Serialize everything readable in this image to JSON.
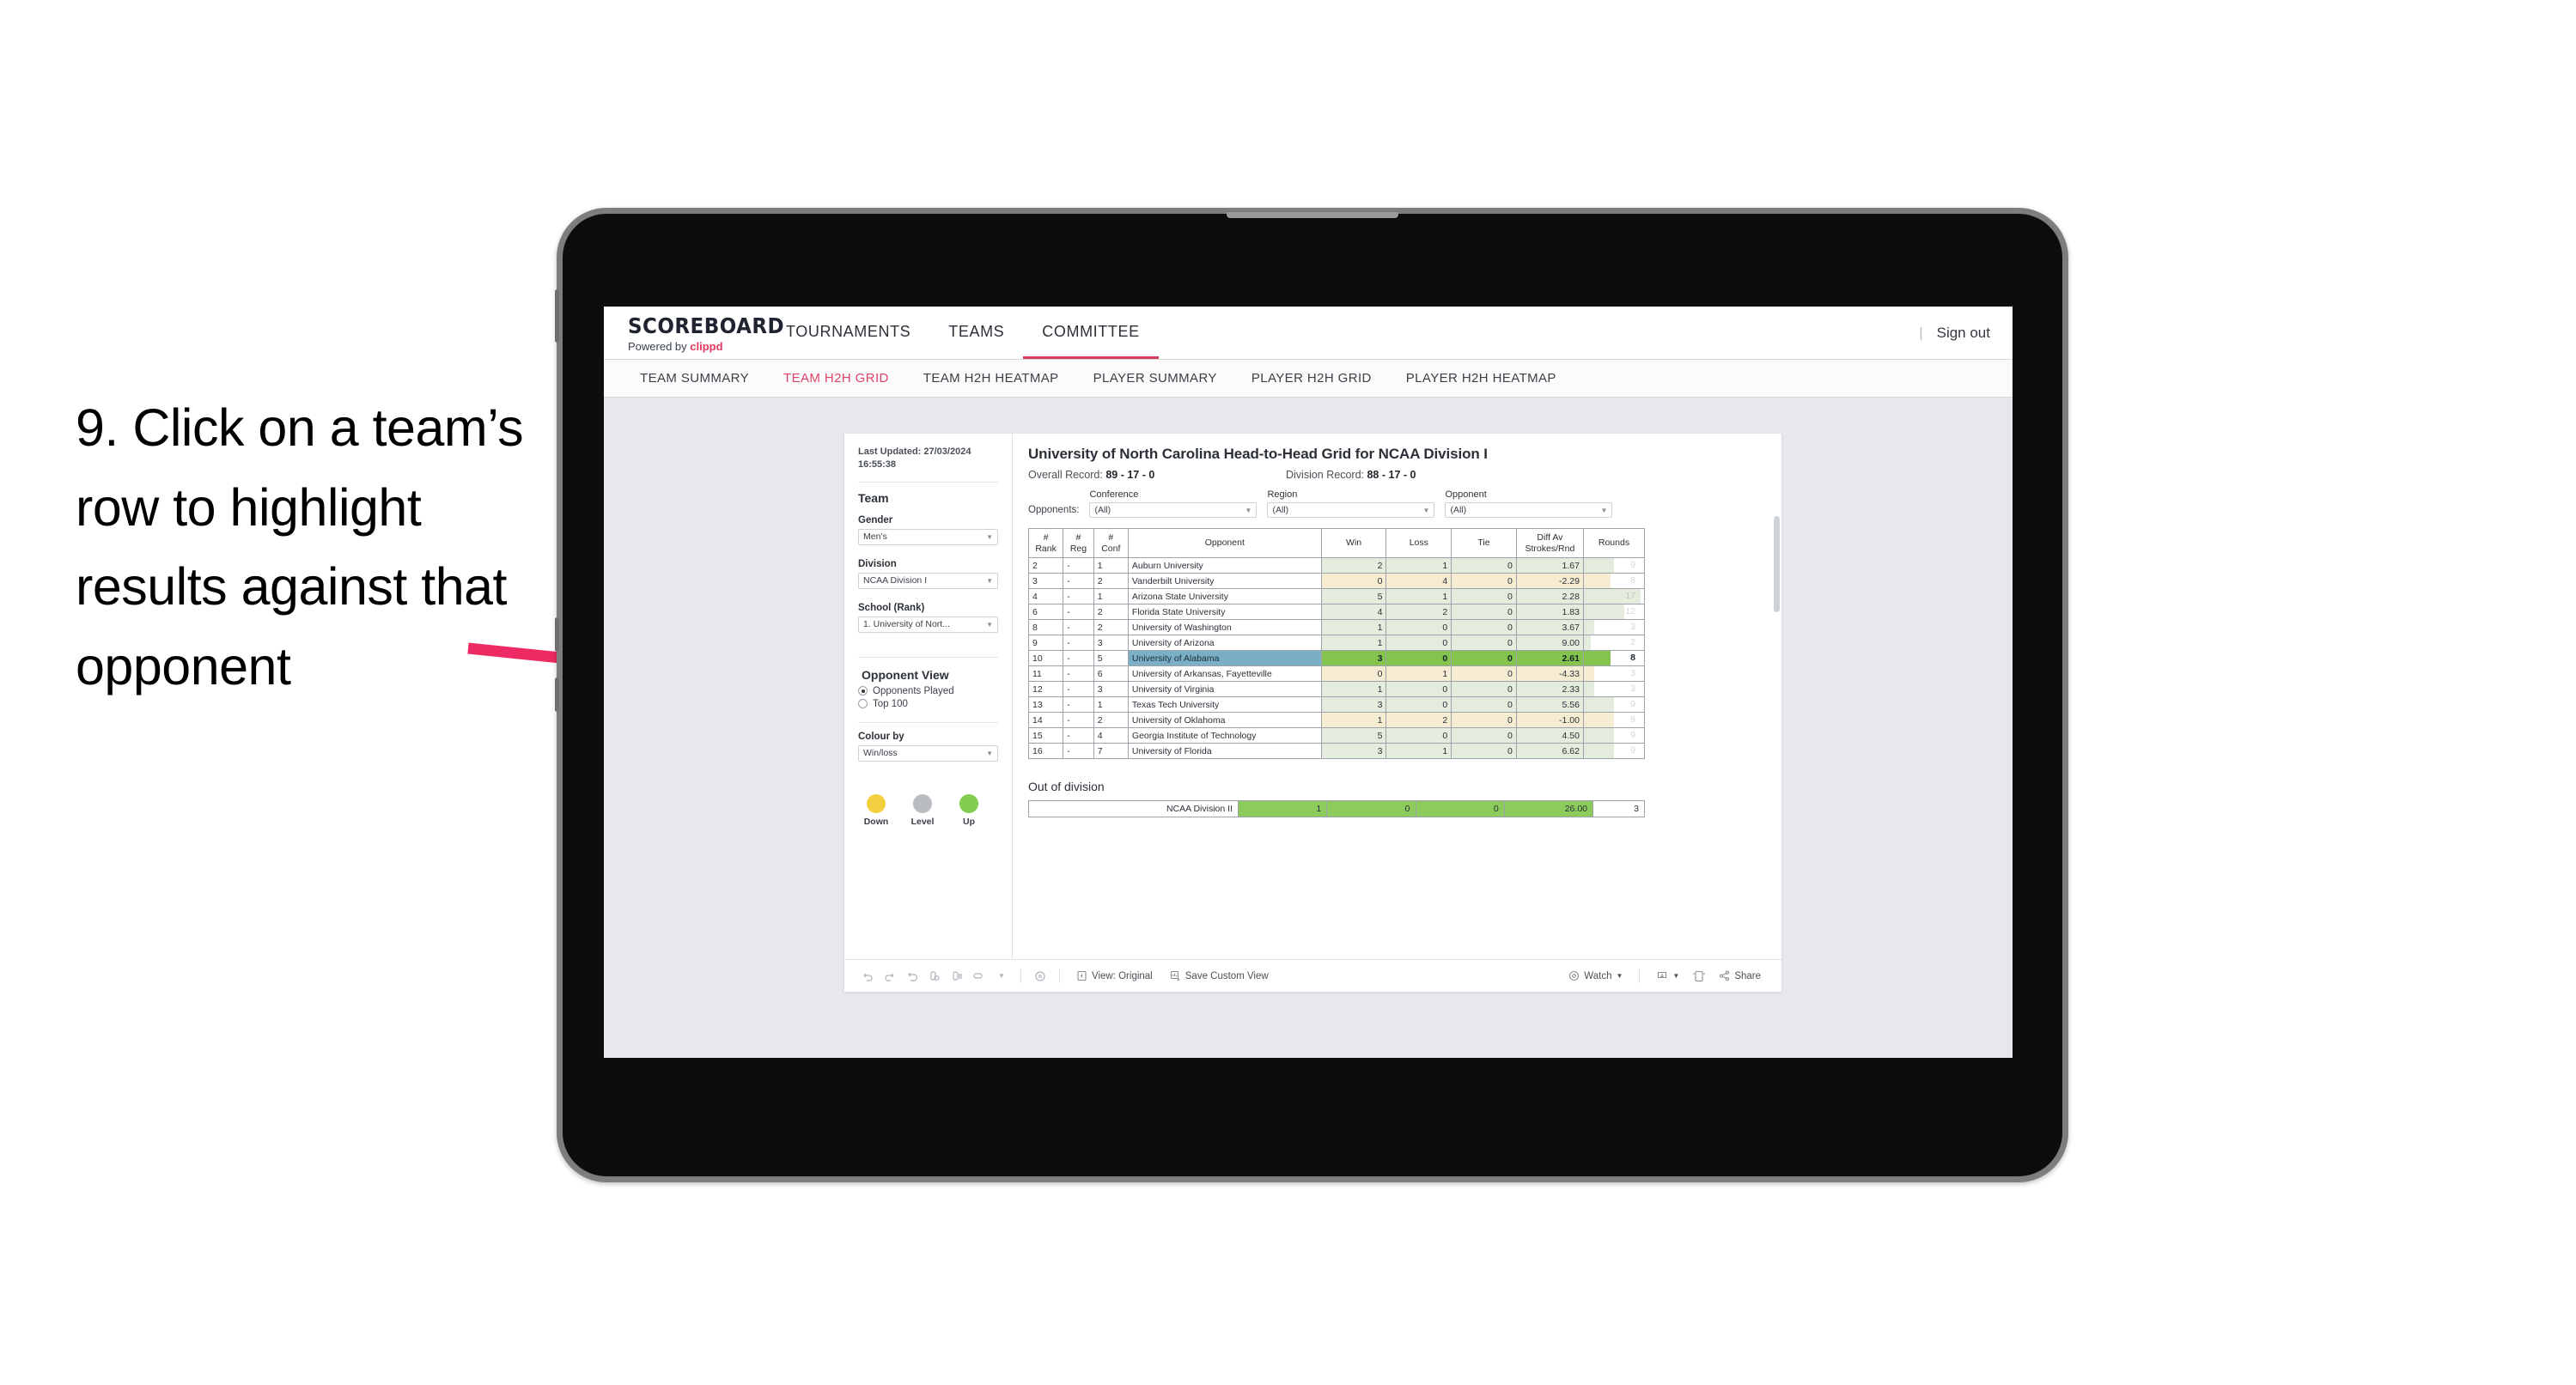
{
  "annotation": {
    "text": "9. Click on a team’s row to highlight results against that opponent",
    "arrow_color": "#ED2A63"
  },
  "app": {
    "brand": {
      "title": "SCOREBOARD",
      "powered_prefix": "Powered by ",
      "powered_name": "clippd"
    },
    "topnav": [
      {
        "label": "TOURNAMENTS",
        "active": false
      },
      {
        "label": "TEAMS",
        "active": false
      },
      {
        "label": "COMMITTEE",
        "active": true
      }
    ],
    "sign_out": "Sign out",
    "divider": "|",
    "subnav": [
      {
        "label": "TEAM SUMMARY",
        "active": false
      },
      {
        "label": "TEAM H2H GRID",
        "active": true
      },
      {
        "label": "TEAM H2H HEATMAP",
        "active": false
      },
      {
        "label": "PLAYER SUMMARY",
        "active": false
      },
      {
        "label": "PLAYER H2H GRID",
        "active": false
      },
      {
        "label": "PLAYER H2H HEATMAP",
        "active": false
      }
    ]
  },
  "sidebar": {
    "last_updated": "Last Updated: 27/03/2024 16:55:38",
    "team_heading": "Team",
    "filters": [
      {
        "label": "Gender",
        "value": "Men’s"
      },
      {
        "label": "Division",
        "value": "NCAA Division I"
      },
      {
        "label": "School (Rank)",
        "value": "1. University of Nort..."
      }
    ],
    "opponent_view": {
      "heading": "Opponent View",
      "options": [
        {
          "label": "Opponents Played",
          "selected": true
        },
        {
          "label": "Top 100",
          "selected": false
        }
      ]
    },
    "colour_by": {
      "label": "Colour by",
      "value": "Win/loss"
    },
    "legend": [
      {
        "label": "Down",
        "color": "#F2CF3F"
      },
      {
        "label": "Level",
        "color": "#B9BCC0"
      },
      {
        "label": "Up",
        "color": "#82CC4D"
      }
    ]
  },
  "main": {
    "title": "University of North Carolina Head-to-Head Grid for NCAA Division I",
    "overall_record_label": "Overall Record: ",
    "overall_record_value": "89 - 17 - 0",
    "division_record_label": "Division Record: ",
    "division_record_value": "88 - 17 - 0",
    "opponents_label": "Opponents:",
    "opponent_filters": [
      {
        "label": "Conference",
        "value": "(All)"
      },
      {
        "label": "Region",
        "value": "(All)"
      },
      {
        "label": "Opponent",
        "value": "(All)"
      }
    ],
    "table": {
      "headers": [
        "#\nRank",
        "#\nReg",
        "#\nConf",
        "Opponent",
        "Win",
        "Loss",
        "Tie",
        "Diff Av\nStrokes/Rnd",
        "Rounds"
      ],
      "header_parts": [
        {
          "l1": "#",
          "l2": "Rank"
        },
        {
          "l1": "#",
          "l2": "Reg"
        },
        {
          "l1": "#",
          "l2": "Conf"
        },
        {
          "l1": "Opponent",
          "l2": ""
        },
        {
          "l1": "Win",
          "l2": ""
        },
        {
          "l1": "Loss",
          "l2": ""
        },
        {
          "l1": "Tie",
          "l2": ""
        },
        {
          "l1": "Diff Av",
          "l2": "Strokes/Rnd"
        },
        {
          "l1": "Rounds",
          "l2": ""
        }
      ],
      "rows": [
        {
          "rank": "2",
          "reg": "-",
          "conf": "1",
          "opponent": "Auburn University",
          "win": "2",
          "loss": "1",
          "tie": "0",
          "diff": "1.67",
          "rounds": "9",
          "result": "win",
          "selected": false,
          "rounds_pct": 50
        },
        {
          "rank": "3",
          "reg": "-",
          "conf": "2",
          "opponent": "Vanderbilt University",
          "win": "0",
          "loss": "4",
          "tie": "0",
          "diff": "-2.29",
          "rounds": "8",
          "result": "loss",
          "selected": false,
          "rounds_pct": 44
        },
        {
          "rank": "4",
          "reg": "-",
          "conf": "1",
          "opponent": "Arizona State University",
          "win": "5",
          "loss": "1",
          "tie": "0",
          "diff": "2.28",
          "rounds": "17",
          "result": "win",
          "selected": false,
          "rounds_pct": 94
        },
        {
          "rank": "6",
          "reg": "-",
          "conf": "2",
          "opponent": "Florida State University",
          "win": "4",
          "loss": "2",
          "tie": "0",
          "diff": "1.83",
          "rounds": "12",
          "result": "win",
          "selected": false,
          "rounds_pct": 67
        },
        {
          "rank": "8",
          "reg": "-",
          "conf": "2",
          "opponent": "University of Washington",
          "win": "1",
          "loss": "0",
          "tie": "0",
          "diff": "3.67",
          "rounds": "3",
          "result": "win",
          "selected": false,
          "rounds_pct": 17
        },
        {
          "rank": "9",
          "reg": "-",
          "conf": "3",
          "opponent": "University of Arizona",
          "win": "1",
          "loss": "0",
          "tie": "0",
          "diff": "9.00",
          "rounds": "2",
          "result": "win",
          "selected": false,
          "rounds_pct": 11
        },
        {
          "rank": "10",
          "reg": "-",
          "conf": "5",
          "opponent": "University of Alabama",
          "win": "3",
          "loss": "0",
          "tie": "0",
          "diff": "2.61",
          "rounds": "8",
          "result": "win",
          "selected": true,
          "rounds_pct": 44
        },
        {
          "rank": "11",
          "reg": "-",
          "conf": "6",
          "opponent": "University of Arkansas, Fayetteville",
          "win": "0",
          "loss": "1",
          "tie": "0",
          "diff": "-4.33",
          "rounds": "3",
          "result": "loss",
          "selected": false,
          "rounds_pct": 17
        },
        {
          "rank": "12",
          "reg": "-",
          "conf": "3",
          "opponent": "University of Virginia",
          "win": "1",
          "loss": "0",
          "tie": "0",
          "diff": "2.33",
          "rounds": "3",
          "result": "win",
          "selected": false,
          "rounds_pct": 17
        },
        {
          "rank": "13",
          "reg": "-",
          "conf": "1",
          "opponent": "Texas Tech University",
          "win": "3",
          "loss": "0",
          "tie": "0",
          "diff": "5.56",
          "rounds": "9",
          "result": "win",
          "selected": false,
          "rounds_pct": 50
        },
        {
          "rank": "14",
          "reg": "-",
          "conf": "2",
          "opponent": "University of Oklahoma",
          "win": "1",
          "loss": "2",
          "tie": "0",
          "diff": "-1.00",
          "rounds": "9",
          "result": "loss",
          "selected": false,
          "rounds_pct": 50
        },
        {
          "rank": "15",
          "reg": "-",
          "conf": "4",
          "opponent": "Georgia Institute of Technology",
          "win": "5",
          "loss": "0",
          "tie": "0",
          "diff": "4.50",
          "rounds": "9",
          "result": "win",
          "selected": false,
          "rounds_pct": 50
        },
        {
          "rank": "16",
          "reg": "-",
          "conf": "7",
          "opponent": "University of Florida",
          "win": "3",
          "loss": "1",
          "tie": "0",
          "diff": "6.62",
          "rounds": "9",
          "result": "win",
          "selected": false,
          "rounds_pct": 50
        }
      ]
    },
    "out_of_division": {
      "heading": "Out of division",
      "row": {
        "label": "NCAA Division II",
        "win": "1",
        "loss": "0",
        "tie": "0",
        "diff": "26.00",
        "rounds": "3"
      }
    }
  },
  "toolbar": {
    "icons": [
      "undo-icon",
      "redo-icon",
      "revert-icon",
      "refresh-data-icon",
      "pause-updates-icon",
      "presentation-mode-icon"
    ],
    "view_original": "View: Original",
    "save_custom_view": "Save Custom View",
    "watch": "Watch",
    "share": "Share"
  },
  "chart_data": {
    "type": "table",
    "title": "University of North Carolina Head-to-Head Grid for NCAA Division I",
    "columns": [
      "#Rank",
      "#Reg",
      "#Conf",
      "Opponent",
      "Win",
      "Loss",
      "Tie",
      "Diff Av Strokes/Rnd",
      "Rounds"
    ],
    "rows": [
      [
        "2",
        "-",
        "1",
        "Auburn University",
        2,
        1,
        0,
        1.67,
        9
      ],
      [
        "3",
        "-",
        "2",
        "Vanderbilt University",
        0,
        4,
        0,
        -2.29,
        8
      ],
      [
        "4",
        "-",
        "1",
        "Arizona State University",
        5,
        1,
        0,
        2.28,
        17
      ],
      [
        "6",
        "-",
        "2",
        "Florida State University",
        4,
        2,
        0,
        1.83,
        12
      ],
      [
        "8",
        "-",
        "2",
        "University of Washington",
        1,
        0,
        0,
        3.67,
        3
      ],
      [
        "9",
        "-",
        "3",
        "University of Arizona",
        1,
        0,
        0,
        9.0,
        2
      ],
      [
        "10",
        "-",
        "5",
        "University of Alabama",
        3,
        0,
        0,
        2.61,
        8
      ],
      [
        "11",
        "-",
        "6",
        "University of Arkansas, Fayetteville",
        0,
        1,
        0,
        -4.33,
        3
      ],
      [
        "12",
        "-",
        "3",
        "University of Virginia",
        1,
        0,
        0,
        2.33,
        3
      ],
      [
        "13",
        "-",
        "1",
        "Texas Tech University",
        3,
        0,
        0,
        5.56,
        9
      ],
      [
        "14",
        "-",
        "2",
        "University of Oklahoma",
        1,
        2,
        0,
        -1.0,
        9
      ],
      [
        "15",
        "-",
        "4",
        "Georgia Institute of Technology",
        5,
        0,
        0,
        4.5,
        9
      ],
      [
        "16",
        "-",
        "7",
        "University of Florida",
        3,
        1,
        0,
        6.62,
        9
      ]
    ],
    "highlighted_row": "University of Alabama",
    "out_of_division": [
      [
        "NCAA Division II",
        1,
        0,
        0,
        26.0,
        3
      ]
    ],
    "legend": [
      {
        "label": "Down",
        "color": "#F2CF3F"
      },
      {
        "label": "Level",
        "color": "#B9BCC0"
      },
      {
        "label": "Up",
        "color": "#82CC4D"
      }
    ]
  }
}
